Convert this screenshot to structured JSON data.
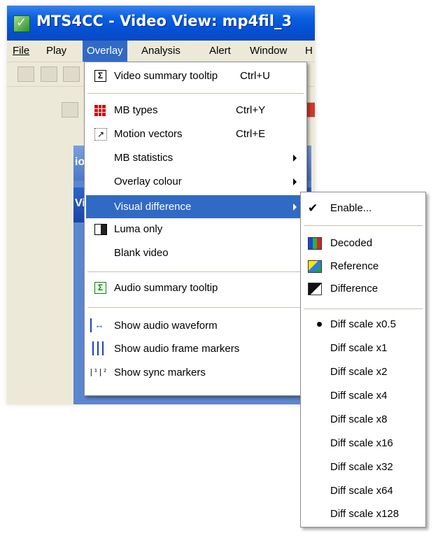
{
  "window": {
    "title": "MTS4CC - Video View: mp4fil_3",
    "menubar": {
      "items": [
        {
          "label": "File"
        },
        {
          "label": "Play"
        },
        {
          "label": "Overlay"
        },
        {
          "label": "Analysis"
        },
        {
          "label": "Alert"
        },
        {
          "label": "Window"
        },
        {
          "label": "H"
        }
      ],
      "active": "Overlay"
    },
    "panel_text_1": "io",
    "panel_text_2": "Vi"
  },
  "overlay_menu": {
    "items": [
      {
        "label": "Video summary tooltip",
        "shortcut": "Ctrl+U",
        "icon": "sigma-icon"
      },
      {
        "label": "MB types",
        "shortcut": "Ctrl+Y",
        "icon": "mb-grid-icon"
      },
      {
        "label": "Motion vectors",
        "shortcut": "Ctrl+E",
        "icon": "motion-vector-icon"
      },
      {
        "label": "MB statistics",
        "submenu": true
      },
      {
        "label": "Overlay colour",
        "submenu": true
      },
      {
        "label": "Visual difference",
        "submenu": true,
        "highlighted": true
      },
      {
        "label": "Luma only",
        "icon": "luma-icon"
      },
      {
        "label": "Blank video"
      },
      {
        "label": "Audio summary tooltip",
        "icon": "sigma-green-icon"
      },
      {
        "label": "Show audio waveform",
        "icon": "waveform-icon"
      },
      {
        "label": "Show audio frame markers",
        "icon": "frame-markers-icon"
      },
      {
        "label": "Show sync markers",
        "icon": "sync-markers-icon"
      }
    ]
  },
  "visual_difference_menu": {
    "items": [
      {
        "label": "Enable...",
        "checked": true
      },
      {
        "label": "Decoded",
        "icon": "decoded-icon"
      },
      {
        "label": "Reference",
        "icon": "reference-icon"
      },
      {
        "label": "Difference",
        "icon": "difference-icon"
      },
      {
        "label": "Diff scale x0.5",
        "selected": true
      },
      {
        "label": "Diff scale x1"
      },
      {
        "label": "Diff scale x2"
      },
      {
        "label": "Diff scale x4"
      },
      {
        "label": "Diff scale x8"
      },
      {
        "label": "Diff scale x16"
      },
      {
        "label": "Diff scale x32"
      },
      {
        "label": "Diff scale x64"
      },
      {
        "label": "Diff scale x128"
      }
    ]
  },
  "colors": {
    "highlight": "#316ac5",
    "titlebar": "#0a5fe0",
    "menu_bg": "#ffffff",
    "chrome": "#ece9d8"
  }
}
